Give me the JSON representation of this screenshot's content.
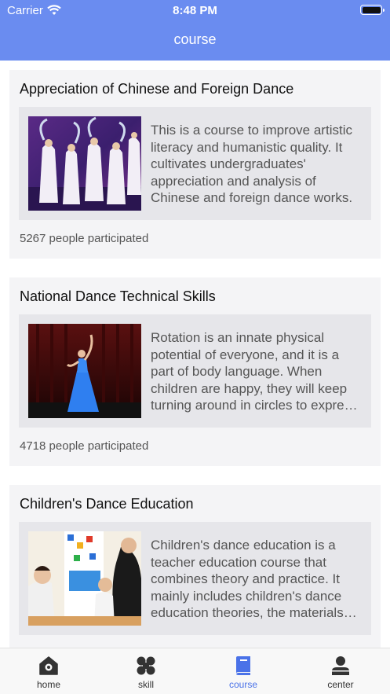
{
  "status_bar": {
    "carrier": "Carrier",
    "time": "8:48 PM"
  },
  "header": {
    "title": "course"
  },
  "courses": [
    {
      "title": "Appreciation of Chinese and Foreign Dance",
      "image": "dance-performance-photo",
      "description": "This is a course to improve artistic literacy and humanistic quality. It cultivates undergraduates' appreciation and analysis of Chinese and foreign dance works.",
      "participants": "5267 people participated"
    },
    {
      "title": "National Dance Technical Skills",
      "image": "solo-dancer-photo",
      "description": "Rotation is an innate physical potential of everyone, and it is a part of body language. When children are happy, they will keep turning around in circles to express themselves.",
      "participants": "4718  people participated"
    },
    {
      "title": "Children's Dance Education",
      "image": "children-classroom-photo",
      "description": "Children's dance education is a teacher education course that combines theory and practice. It mainly includes children's dance education theories, the materials and methods of teaching.",
      "participants": ""
    }
  ],
  "tabbar": {
    "items": [
      {
        "label": "home",
        "icon": "home-icon"
      },
      {
        "label": "skill",
        "icon": "skill-icon"
      },
      {
        "label": "course",
        "icon": "book-icon",
        "active": true
      },
      {
        "label": "center",
        "icon": "person-icon"
      }
    ]
  },
  "colors": {
    "accent": "#6a8cf0",
    "active_tab": "#4a72e8",
    "card": "#f4f4f6",
    "card_body": "#e6e6ea"
  }
}
